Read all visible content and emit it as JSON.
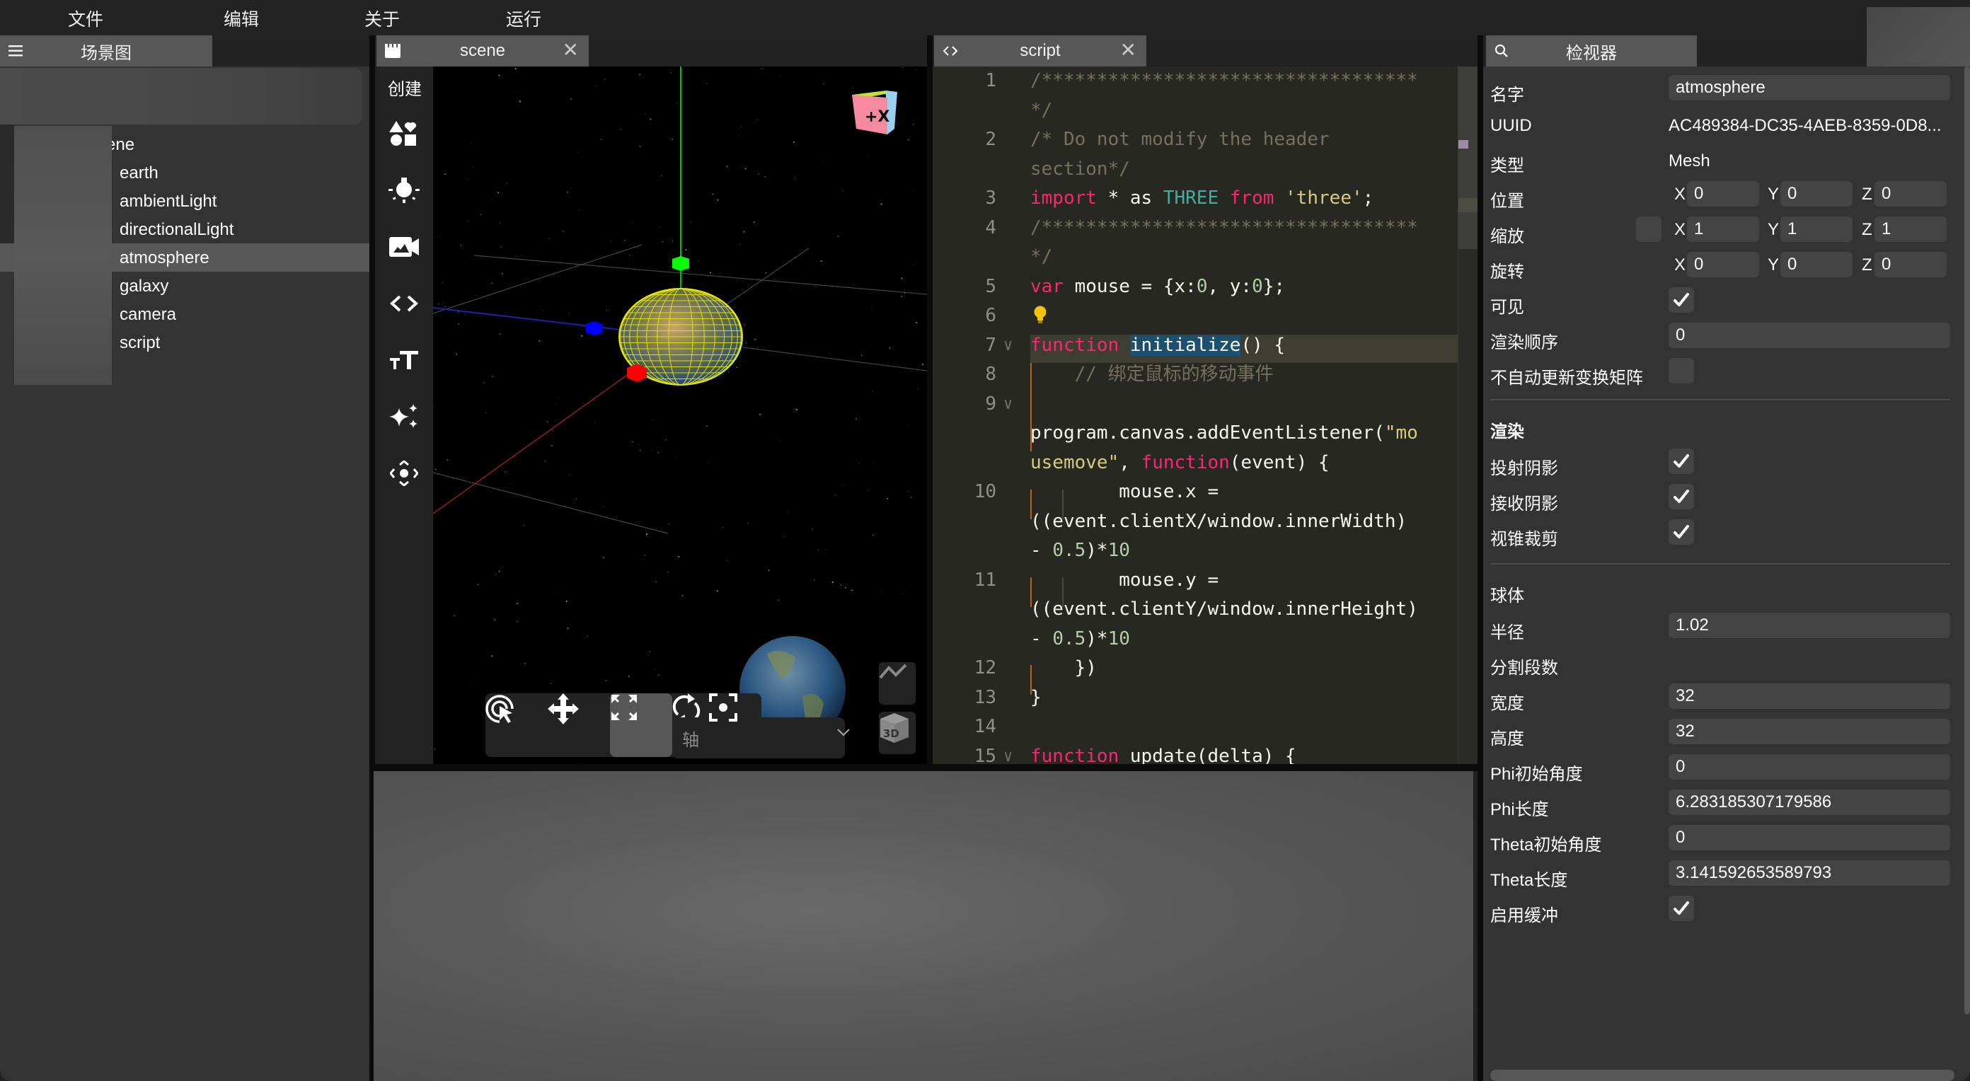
{
  "menu": {
    "items": [
      "文件",
      "编辑",
      "关于",
      "运行"
    ]
  },
  "scene_graph": {
    "tab_label": "场景图",
    "tab_icon": "hamburger-menu-icon",
    "root_label": "ene",
    "items": [
      {
        "label": "earth",
        "selected": false
      },
      {
        "label": "ambientLight",
        "selected": false
      },
      {
        "label": "directionalLight",
        "selected": false
      },
      {
        "label": "atmosphere",
        "selected": true
      },
      {
        "label": "galaxy",
        "selected": false
      },
      {
        "label": "camera",
        "selected": false
      },
      {
        "label": "script",
        "selected": false
      }
    ]
  },
  "scene_panel": {
    "tab_label": "scene",
    "tab_icon": "clapperboard-icon",
    "close_icon": "close-icon",
    "create_label": "创建",
    "create_tools": [
      {
        "name": "shapes-icon"
      },
      {
        "name": "light-bulb-icon"
      },
      {
        "name": "camera-icon"
      },
      {
        "name": "code-icon"
      },
      {
        "name": "text-size-icon"
      },
      {
        "name": "sparkles-icon"
      },
      {
        "name": "move-arrows-icon"
      }
    ],
    "view_cube_label": "+X",
    "bottom_tools": [
      {
        "name": "select-pointer-icon",
        "active": false
      },
      {
        "name": "translate-icon",
        "active": false
      },
      {
        "name": "scale-icon",
        "active": true
      },
      {
        "name": "rotate-icon",
        "active": false
      }
    ],
    "axis_select_label": "轴",
    "focus_icon": "focus-target-icon",
    "stats_icon": "stats-chart-icon",
    "mode_3d_label": "3D",
    "colors": {
      "x_axis": "#ff0000",
      "y_axis": "#00ff00",
      "z_axis": "#0000ff",
      "wireframe": "#e8e800"
    }
  },
  "script_panel": {
    "tab_label": "script",
    "tab_icon": "code-brackets-icon",
    "close_icon": "close-icon",
    "lines": [
      {
        "n": "1",
        "fold": "",
        "tokens": [
          [
            "c-com",
            "/**********************************"
          ]
        ]
      },
      {
        "n": "",
        "fold": "",
        "tokens": [
          [
            "c-com",
            "*/"
          ]
        ]
      },
      {
        "n": "2",
        "fold": "",
        "tokens": [
          [
            "c-com",
            "/* Do not modify the header"
          ]
        ]
      },
      {
        "n": "",
        "fold": "",
        "tokens": [
          [
            "c-com",
            "section*/"
          ]
        ]
      },
      {
        "n": "3",
        "fold": "",
        "tokens": [
          [
            "c-kw",
            "import"
          ],
          [
            "",
            " * as "
          ],
          [
            "c-cls",
            "THREE"
          ],
          [
            "",
            " "
          ],
          [
            "c-kw",
            "from"
          ],
          [
            "",
            " "
          ],
          [
            "c-str",
            "'three'"
          ],
          [
            "",
            ";"
          ]
        ]
      },
      {
        "n": "4",
        "fold": "",
        "tokens": [
          [
            "c-com",
            "/**********************************"
          ]
        ]
      },
      {
        "n": "",
        "fold": "",
        "tokens": [
          [
            "c-com",
            "*/"
          ]
        ]
      },
      {
        "n": "5",
        "fold": "",
        "tokens": [
          [
            "c-kw",
            "var"
          ],
          [
            "",
            " mouse = {x:"
          ],
          [
            "c-num",
            "0"
          ],
          [
            "",
            ", y:"
          ],
          [
            "c-num",
            "0"
          ],
          [
            "",
            "};"
          ]
        ]
      },
      {
        "n": "6",
        "fold": "",
        "tokens": []
      },
      {
        "n": "7",
        "fold": "∨",
        "tokens": [
          [
            "c-kw",
            "function"
          ],
          [
            "",
            " "
          ],
          [
            "c-sel",
            "initialize"
          ],
          [
            "",
            "() {"
          ]
        ]
      },
      {
        "n": "8",
        "fold": "",
        "tokens": [
          [
            "",
            "    "
          ],
          [
            "c-com",
            "// 绑定鼠标的移动事件"
          ]
        ]
      },
      {
        "n": "9",
        "fold": "∨",
        "tokens": []
      },
      {
        "n": "",
        "fold": "",
        "tokens": [
          [
            "",
            "program.canvas.addEventListener("
          ],
          [
            "c-str",
            "\"mo"
          ]
        ]
      },
      {
        "n": "",
        "fold": "",
        "tokens": [
          [
            "c-str",
            "usemove\""
          ],
          [
            "",
            ", "
          ],
          [
            "c-kw",
            "function"
          ],
          [
            "",
            "(event) {"
          ]
        ]
      },
      {
        "n": "10",
        "fold": "",
        "tokens": [
          [
            "",
            "        mouse.x ="
          ]
        ]
      },
      {
        "n": "",
        "fold": "",
        "tokens": [
          [
            "",
            "((event.clientX/window.innerWidth)"
          ]
        ]
      },
      {
        "n": "",
        "fold": "",
        "tokens": [
          [
            "",
            "- "
          ],
          [
            "c-num",
            "0.5"
          ],
          [
            "",
            ")*"
          ],
          [
            "c-num",
            "10"
          ]
        ]
      },
      {
        "n": "11",
        "fold": "",
        "tokens": [
          [
            "",
            "        mouse.y ="
          ]
        ]
      },
      {
        "n": "",
        "fold": "",
        "tokens": [
          [
            "",
            "((event.clientY/window.innerHeight)"
          ]
        ]
      },
      {
        "n": "",
        "fold": "",
        "tokens": [
          [
            "",
            "- "
          ],
          [
            "c-num",
            "0.5"
          ],
          [
            "",
            ")*"
          ],
          [
            "c-num",
            "10"
          ]
        ]
      },
      {
        "n": "12",
        "fold": "",
        "tokens": [
          [
            "",
            "    })"
          ]
        ]
      },
      {
        "n": "13",
        "fold": "",
        "tokens": [
          [
            "",
            "}"
          ]
        ]
      },
      {
        "n": "14",
        "fold": "",
        "tokens": []
      },
      {
        "n": "15",
        "fold": "∨",
        "tokens": [
          [
            "c-kw",
            "function"
          ],
          [
            "",
            " update(delta) {"
          ]
        ]
      }
    ]
  },
  "inspector": {
    "tab_label": "检视器",
    "tab_icon": "search-icon",
    "name_label": "名字",
    "name_value": "atmosphere",
    "uuid_label": "UUID",
    "uuid_value": "AC489384-DC35-4AEB-8359-0D8...",
    "type_label": "类型",
    "type_value": "Mesh",
    "position_label": "位置",
    "position": {
      "x": "0",
      "y": "0",
      "z": "0"
    },
    "scale_label": "缩放",
    "scale": {
      "x": "1",
      "y": "1",
      "z": "1"
    },
    "rotation_label": "旋转",
    "rotation": {
      "x": "0",
      "y": "0",
      "z": "0"
    },
    "axis_labels": {
      "x": "X",
      "y": "Y",
      "z": "Z"
    },
    "visible_label": "可见",
    "visible": true,
    "render_order_label": "渲染顺序",
    "render_order": "0",
    "no_auto_matrix_label": "不自动更新变换矩阵",
    "no_auto_matrix": false,
    "render_heading": "渲染",
    "cast_shadow_label": "投射阴影",
    "cast_shadow": true,
    "receive_shadow_label": "接收阴影",
    "receive_shadow": true,
    "frustum_cull_label": "视锥裁剪",
    "frustum_cull": true,
    "sphere_heading": "球体",
    "radius_label": "半径",
    "radius": "1.02",
    "segments_label": "分割段数",
    "width_label": "宽度",
    "width_segments": "32",
    "height_label": "高度",
    "height_segments": "32",
    "phi_start_label": "Phi初始角度",
    "phi_start": "0",
    "phi_length_label": "Phi长度",
    "phi_length": "6.283185307179586",
    "theta_start_label": "Theta初始角度",
    "theta_start": "0",
    "theta_length_label": "Theta长度",
    "theta_length": "3.141592653589793",
    "buffer_label": "启用缓冲",
    "buffer": true
  }
}
